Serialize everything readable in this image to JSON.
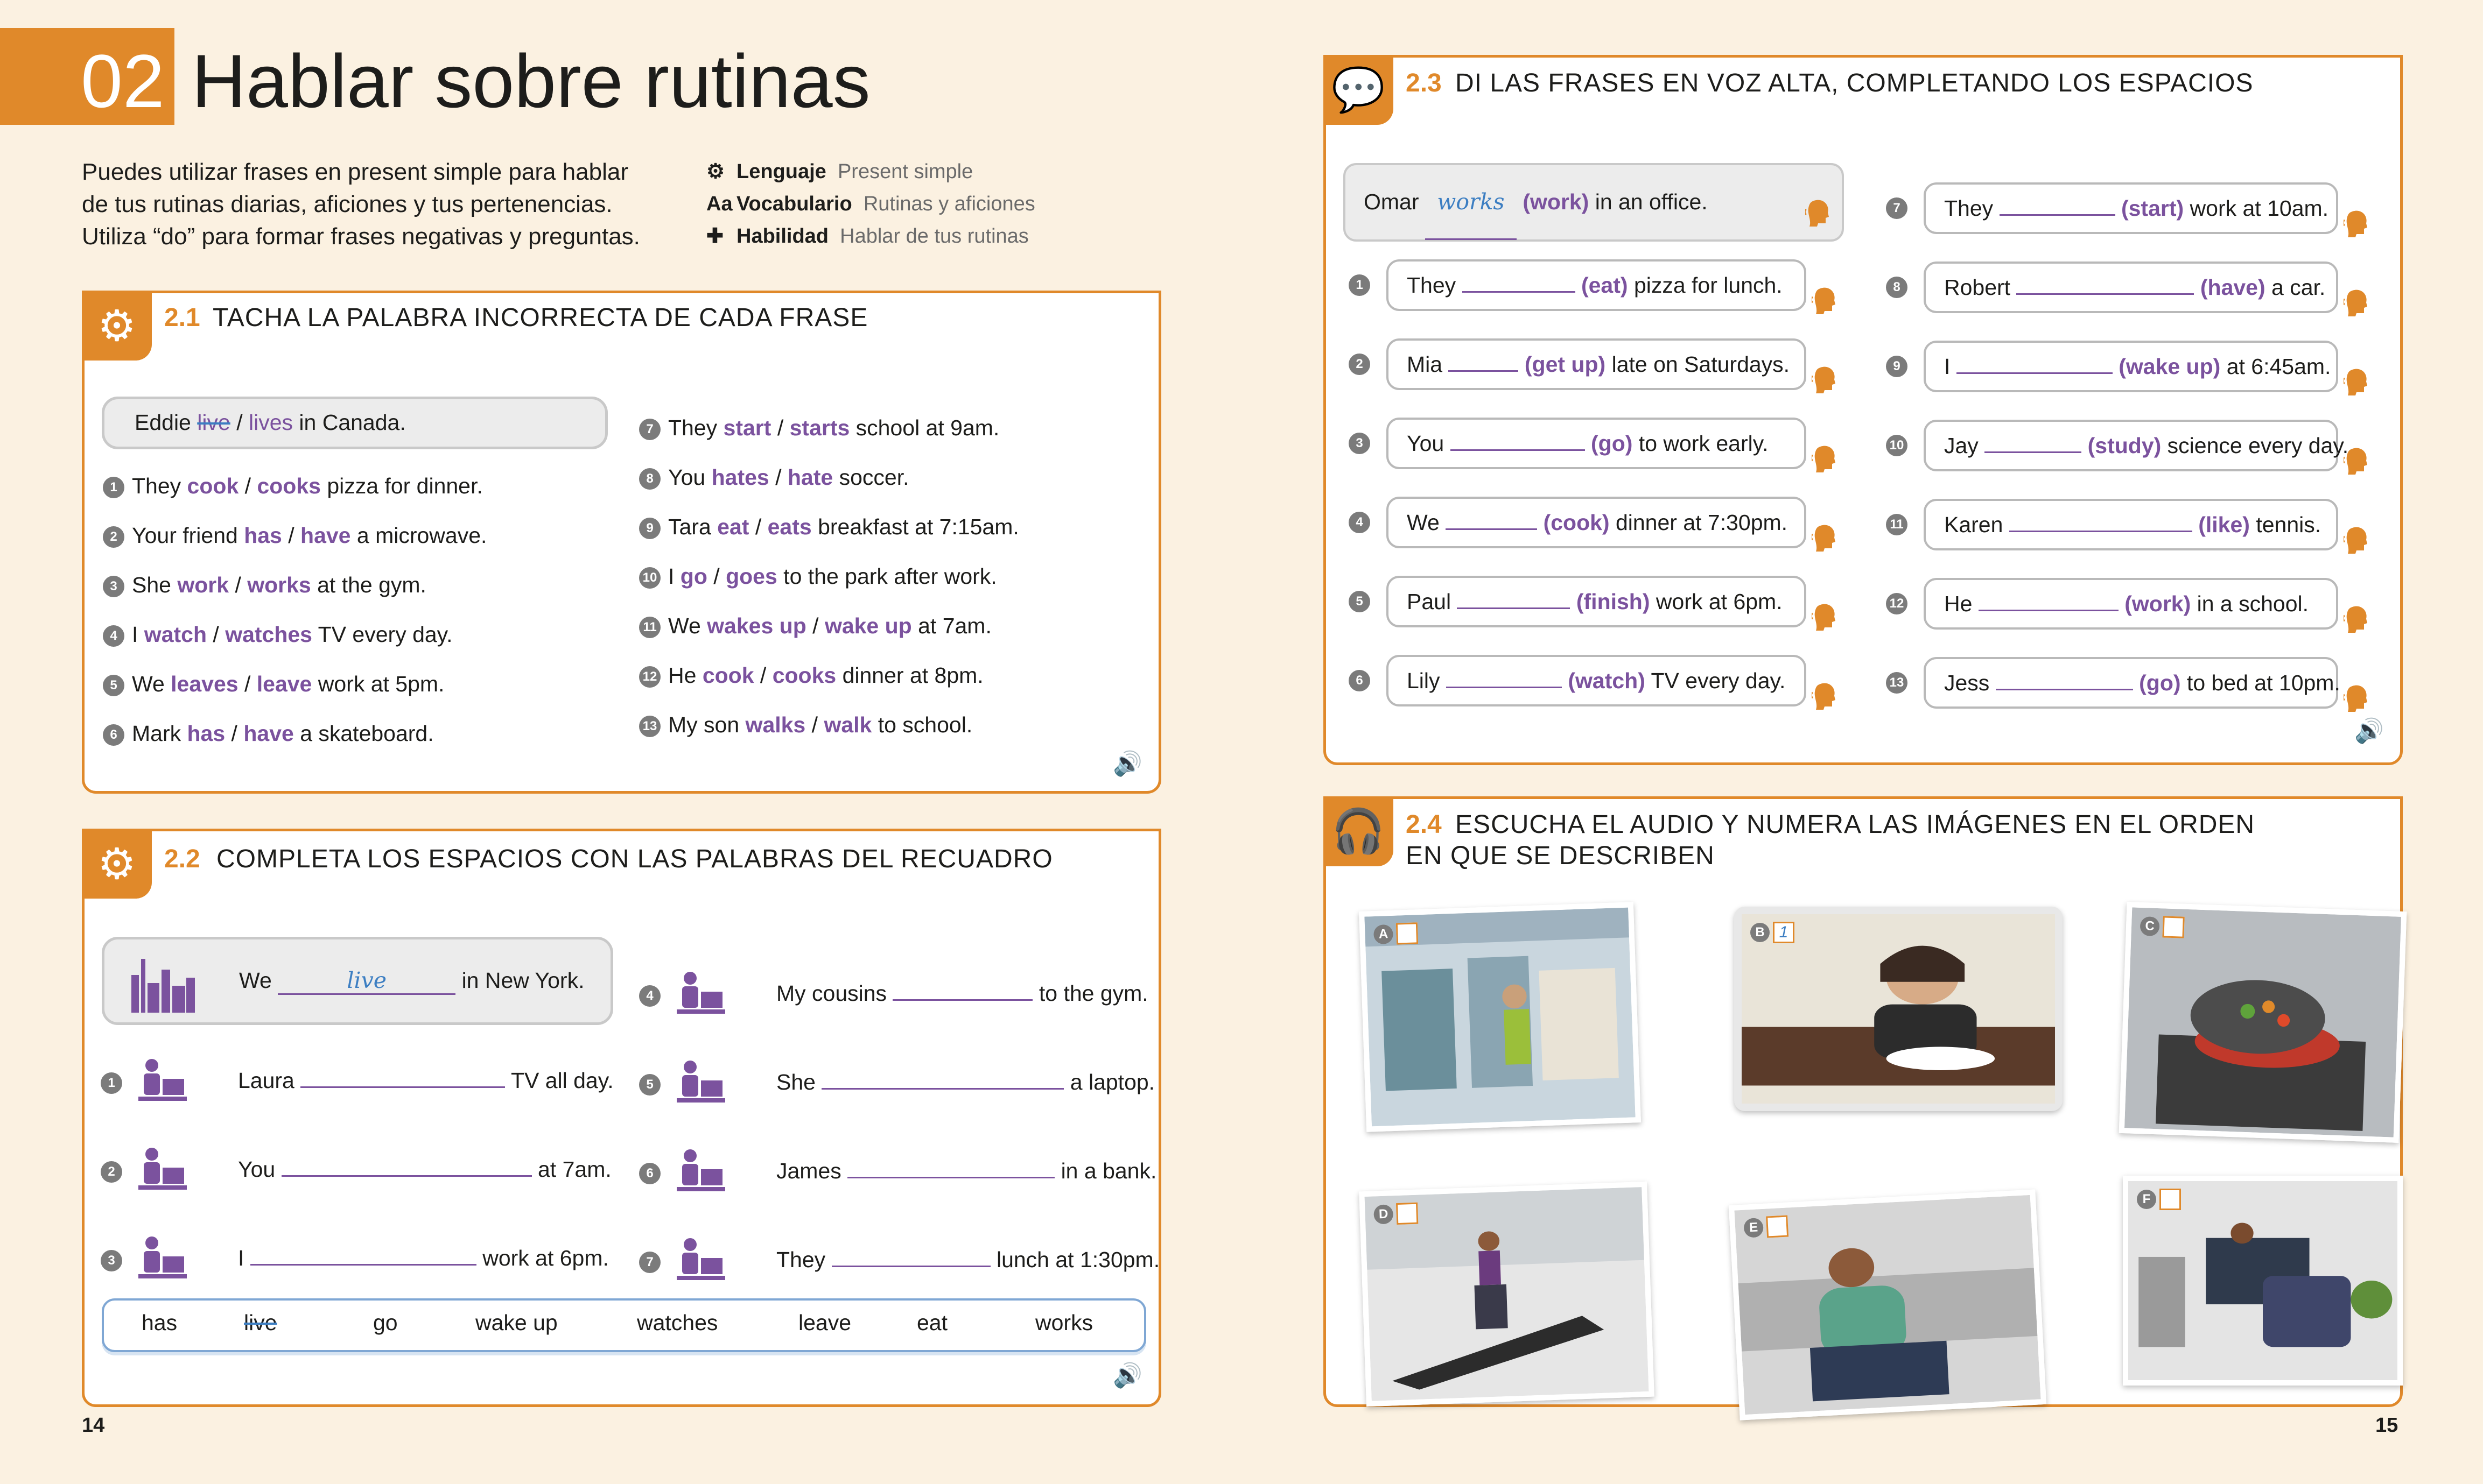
{
  "header": {
    "unit_number": "02",
    "title": "Hablar sobre rutinas"
  },
  "intro": "Puedes utilizar frases en present simple para hablar de tus rutinas diarias, aficiones y tus pertenencias. Utiliza “do” para formar frases negativas y preguntas.",
  "meta": [
    {
      "icon": "gears-icon",
      "label": "Lenguaje",
      "value": "Present simple"
    },
    {
      "icon": "aa-icon",
      "label": "Vocabulario",
      "value": "Rutinas y aficiones"
    },
    {
      "icon": "puzzle-icon",
      "label": "Habilidad",
      "value": "Hablar de tus rutinas"
    }
  ],
  "ex21": {
    "num": "2.1",
    "title": "TACHA LA PALABRA INCORRECTA DE CADA FRASE",
    "example": {
      "pre": "Eddie ",
      "wrong": "live",
      "sep": " / ",
      "right": "lives",
      "post": " in Canada."
    },
    "items": [
      {
        "n": "1",
        "pre": "They ",
        "a": "cook",
        "b": "cooks",
        "post": " pizza for dinner."
      },
      {
        "n": "2",
        "pre": "Your friend ",
        "a": "has",
        "b": "have",
        "post": " a microwave."
      },
      {
        "n": "3",
        "pre": "She ",
        "a": "work",
        "b": "works",
        "post": " at the gym."
      },
      {
        "n": "4",
        "pre": "I ",
        "a": "watch",
        "b": "watches",
        "post": " TV every day."
      },
      {
        "n": "5",
        "pre": "We ",
        "a": "leaves",
        "b": "leave",
        "post": " work at 5pm."
      },
      {
        "n": "6",
        "pre": "Mark ",
        "a": "has",
        "b": "have",
        "post": " a skateboard."
      },
      {
        "n": "7",
        "pre": "They ",
        "a": "start",
        "b": "starts",
        "post": " school at 9am."
      },
      {
        "n": "8",
        "pre": "You ",
        "a": "hates",
        "b": "hate",
        "post": " soccer."
      },
      {
        "n": "9",
        "pre": "Tara ",
        "a": "eat",
        "b": "eats",
        "post": " breakfast at 7:15am."
      },
      {
        "n": "10",
        "pre": "I ",
        "a": "go",
        "b": "goes",
        "post": " to the park after work."
      },
      {
        "n": "11",
        "pre": "We ",
        "a": "wakes up",
        "b": "wake up",
        "post": " at 7am."
      },
      {
        "n": "12",
        "pre": "He ",
        "a": "cook",
        "b": "cooks",
        "post": " dinner at 8pm."
      },
      {
        "n": "13",
        "pre": "My son ",
        "a": "walks",
        "b": "walk",
        "post": " to school."
      }
    ]
  },
  "ex22": {
    "num": "2.2",
    "title": "COMPLETA LOS ESPACIOS CON LAS PALABRAS DEL RECUADRO",
    "example": {
      "pre": "We",
      "answer": "live",
      "post": "in New York."
    },
    "items": [
      {
        "n": "1",
        "pre": "Laura",
        "post": "TV all day."
      },
      {
        "n": "2",
        "pre": "You",
        "post": "at 7am."
      },
      {
        "n": "3",
        "pre": "I",
        "post": "work at 6pm."
      },
      {
        "n": "4",
        "pre": "My cousins",
        "post": "to the gym."
      },
      {
        "n": "5",
        "pre": "She",
        "post": "a laptop."
      },
      {
        "n": "6",
        "pre": "James",
        "post": "in a bank."
      },
      {
        "n": "7",
        "pre": "They",
        "post": "lunch at 1:30pm."
      }
    ],
    "words": [
      "has",
      "live",
      "go",
      "wake up",
      "watches",
      "leave",
      "eat",
      "works"
    ]
  },
  "ex23": {
    "num": "2.3",
    "title": "DI LAS FRASES EN VOZ ALTA, COMPLETANDO LOS ESPACIOS",
    "example": {
      "pre": "Omar",
      "answer": "works",
      "verb": "(work)",
      "post": " in an office."
    },
    "items": [
      {
        "n": "1",
        "pre": "They",
        "verb": "(eat)",
        "post": " pizza for lunch."
      },
      {
        "n": "2",
        "pre": "Mia",
        "verb": "(get up)",
        "post": " late on Saturdays."
      },
      {
        "n": "3",
        "pre": "You",
        "verb": "(go)",
        "post": " to work early."
      },
      {
        "n": "4",
        "pre": "We",
        "verb": "(cook)",
        "post": " dinner at 7:30pm."
      },
      {
        "n": "5",
        "pre": "Paul",
        "verb": "(finish)",
        "post": " work at 6pm."
      },
      {
        "n": "6",
        "pre": "Lily",
        "verb": "(watch)",
        "post": " TV every day."
      },
      {
        "n": "7",
        "pre": "They",
        "verb": "(start)",
        "post": " work at 10am."
      },
      {
        "n": "8",
        "pre": "Robert",
        "verb": "(have)",
        "post": " a car."
      },
      {
        "n": "9",
        "pre": "I",
        "verb": "(wake up)",
        "post": " at 6:45am."
      },
      {
        "n": "10",
        "pre": "Jay",
        "verb": "(study)",
        "post": " science every day."
      },
      {
        "n": "11",
        "pre": "Karen",
        "verb": "(like)",
        "post": " tennis."
      },
      {
        "n": "12",
        "pre": "He",
        "verb": "(work)",
        "post": " in a school."
      },
      {
        "n": "13",
        "pre": "Jess",
        "verb": "(go)",
        "post": " to bed at 10pm."
      }
    ]
  },
  "ex24": {
    "num": "2.4",
    "title_line1": "ESCUCHA EL AUDIO Y NUMERA LAS IMÁGENES EN EL ORDEN",
    "title_line2": "EN QUE SE DESCRIBEN",
    "pictures": [
      {
        "letter": "A",
        "answer": ""
      },
      {
        "letter": "B",
        "answer": "1"
      },
      {
        "letter": "C",
        "answer": ""
      },
      {
        "letter": "D",
        "answer": ""
      },
      {
        "letter": "E",
        "answer": ""
      },
      {
        "letter": "F",
        "answer": ""
      }
    ]
  },
  "pages": {
    "left": "14",
    "right": "15"
  },
  "colors": {
    "accent": "#e0892a",
    "purple": "#7b529e",
    "page_bg": "#fbf1e1"
  }
}
